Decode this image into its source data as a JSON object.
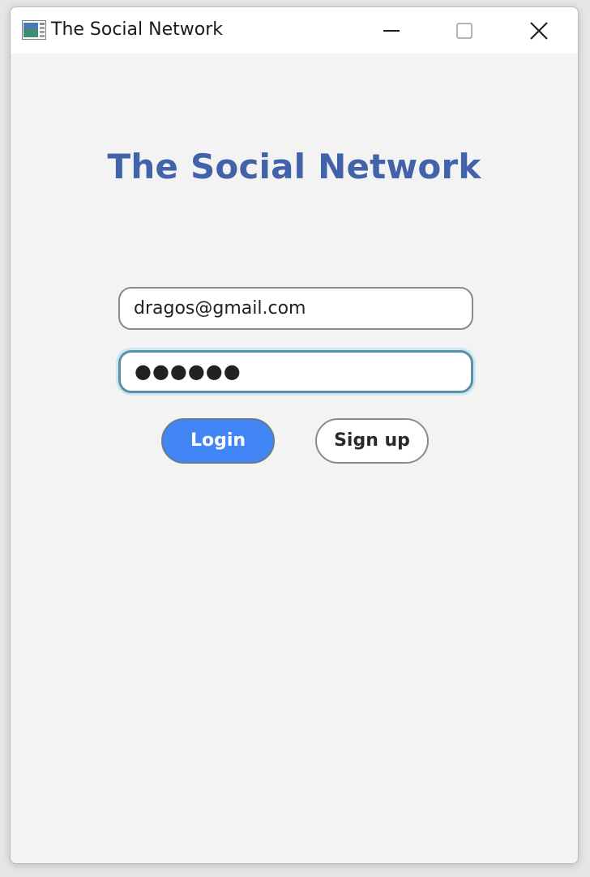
{
  "window": {
    "title": "The Social Network",
    "controls": {
      "minimize_icon": "minimize-icon",
      "maximize_icon": "maximize-icon",
      "close_icon": "close-icon"
    }
  },
  "login": {
    "heading": "The Social Network",
    "email_value": "dragos@gmail.com",
    "password_mask": "●●●●●●",
    "login_label": "Login",
    "signup_label": "Sign up"
  },
  "colors": {
    "heading": "#4262a9",
    "login_button": "#4285f4",
    "background": "#f3f3f3",
    "focus_border": "#5b8fa7"
  }
}
